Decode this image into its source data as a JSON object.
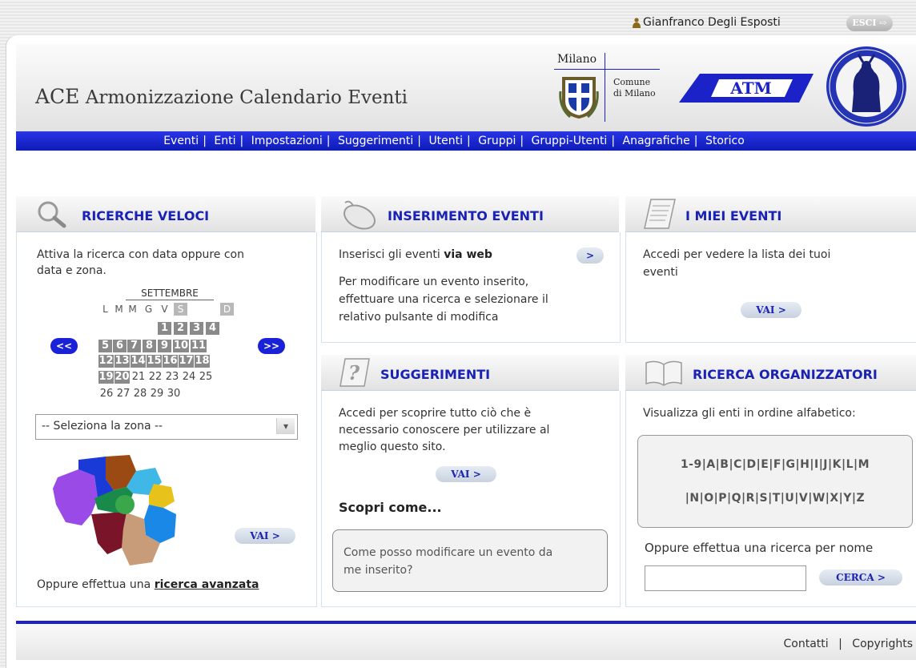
{
  "user": {
    "name": "Gianfranco Degli Esposti",
    "logout_label": "ESCI"
  },
  "app": {
    "title_abbr": "ACE",
    "title_full": "Armonizzazione Calendario Eventi"
  },
  "logos": {
    "milano_top": "Milano",
    "comune_line1": "Comune",
    "comune_line2": "di Milano",
    "atm": "ATM"
  },
  "nav": [
    "Eventi",
    "Enti",
    "Impostazioni",
    "Suggerimenti",
    "Utenti",
    "Gruppi",
    "Gruppi-Utenti",
    "Anagrafiche",
    "Storico"
  ],
  "quick_search": {
    "title": "RICERCHE VELOCI",
    "intro_1": "Attiva la ricerca con data oppure con",
    "intro_2": "data e zona.",
    "month": "SETTEMBRE",
    "weekdays": [
      "L",
      "M",
      "M",
      "G",
      "V",
      "S",
      "D"
    ],
    "prev": "<<",
    "next": ">>",
    "zone_placeholder": "-- Seleziona la zona --",
    "go": "VAI >",
    "advanced_prefix": "Oppure effettua una",
    "advanced_link": "ricerca avanzata"
  },
  "insert": {
    "title": "INSERIMENTO EVENTI",
    "line_prefix": "Inserisci gli eventi",
    "line_bold": "via web",
    "arrow": ">",
    "desc_1": "Per modificare un evento inserito,",
    "desc_2": "effettuare una ricerca e selezionare il",
    "desc_3": "relativo pulsante di modifica"
  },
  "my_events": {
    "title": "I MIEI EVENTI",
    "desc_1": "Accedi per vedere la lista dei tuoi",
    "desc_2": "eventi",
    "go": "VAI >"
  },
  "suggestions": {
    "title": "SUGGERIMENTI",
    "desc_1": "Accedi per scoprire tutto ciò che è",
    "desc_2": "necessario conoscere per utilizzare al",
    "desc_3": "meglio questo sito.",
    "go": "VAI >",
    "discover": "Scopri come...",
    "faq_1": "Come posso modificare un evento da",
    "faq_2": "me inserito?"
  },
  "organizers": {
    "title": "RICERCA ORGANIZZATORI",
    "desc": "Visualizza gli enti in ordine alfabetico:",
    "letters_1": "1-9|A|B|C|D|E|F|G|H|I|J|K|L|M",
    "letters_2": "|N|O|P|Q|R|S|T|U|V|W|X|Y|Z",
    "by_name": "Oppure effettua una ricerca per nome",
    "search_btn": "CERCA >"
  },
  "footer": {
    "contacts": "Contatti",
    "copyrights": "Copyrights"
  }
}
